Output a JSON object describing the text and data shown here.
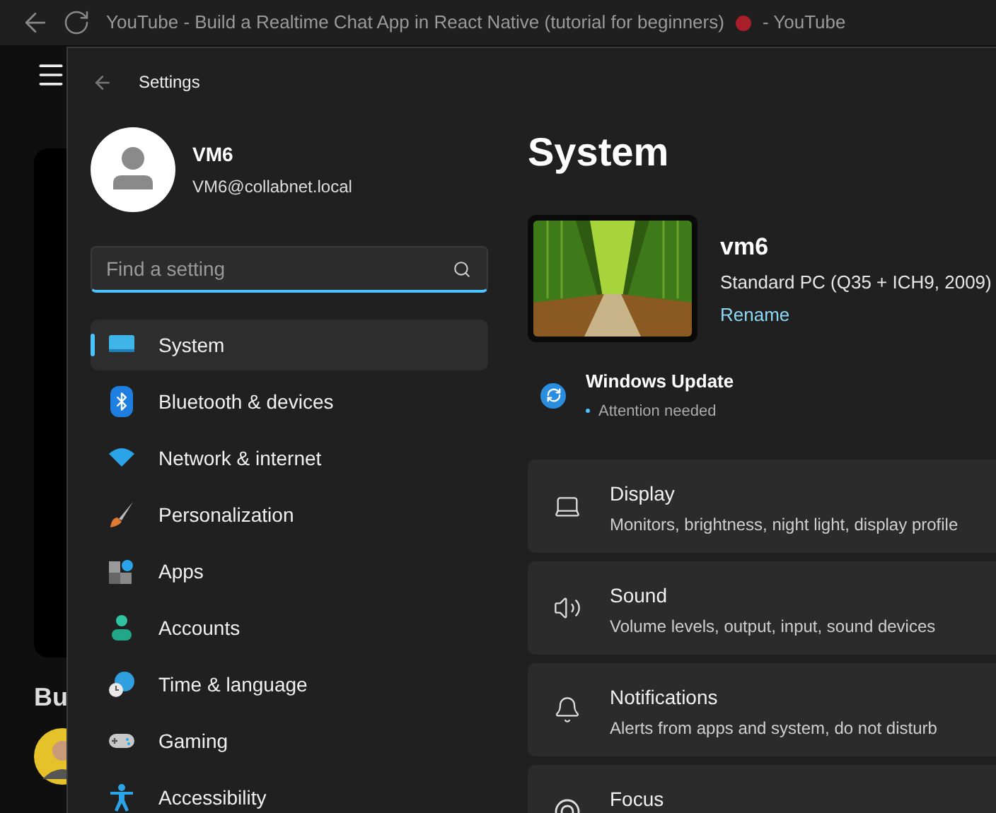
{
  "browser": {
    "title": "YouTube - Build a Realtime Chat App in React Native (tutorial for beginners)",
    "title_suffix": "- YouTube"
  },
  "youtube_page": {
    "video_heading": "Bu"
  },
  "settings": {
    "title": "Settings",
    "user": {
      "name": "VM6",
      "email": "VM6@collabnet.local"
    },
    "search": {
      "placeholder": "Find a setting"
    },
    "nav": [
      {
        "label": "System",
        "selected": true
      },
      {
        "label": "Bluetooth & devices",
        "selected": false
      },
      {
        "label": "Network & internet",
        "selected": false
      },
      {
        "label": "Personalization",
        "selected": false
      },
      {
        "label": "Apps",
        "selected": false
      },
      {
        "label": "Accounts",
        "selected": false
      },
      {
        "label": "Time & language",
        "selected": false
      },
      {
        "label": "Gaming",
        "selected": false
      },
      {
        "label": "Accessibility",
        "selected": false
      }
    ],
    "page_title": "System",
    "device": {
      "name": "vm6",
      "model": "Standard PC (Q35 + ICH9, 2009)",
      "rename": "Rename"
    },
    "update": {
      "title": "Windows Update",
      "status": "Attention needed"
    },
    "cards": [
      {
        "title": "Display",
        "description": "Monitors, brightness, night light, display profile"
      },
      {
        "title": "Sound",
        "description": "Volume levels, output, input, sound devices"
      },
      {
        "title": "Notifications",
        "description": "Alerts from apps and system, do not disturb"
      },
      {
        "title": "Focus"
      }
    ]
  }
}
